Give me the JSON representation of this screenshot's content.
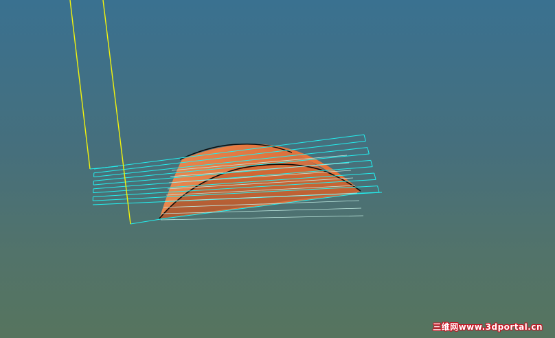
{
  "watermark": {
    "text": "三维网www.3dportal.cn"
  },
  "colors": {
    "background_top": "#3a7190",
    "background_bottom": "#56745e",
    "toolpath": "#22f0f0",
    "tool_axis": "#f4f40a",
    "part_surface": "#e8733a",
    "part_edge": "#0a0a0a",
    "watermark_outline": "#cc1020"
  },
  "icons": {
    "scene": "cam-toolpath-scene",
    "part": "dome-part-shape",
    "tool": "tool-axis-lines"
  }
}
